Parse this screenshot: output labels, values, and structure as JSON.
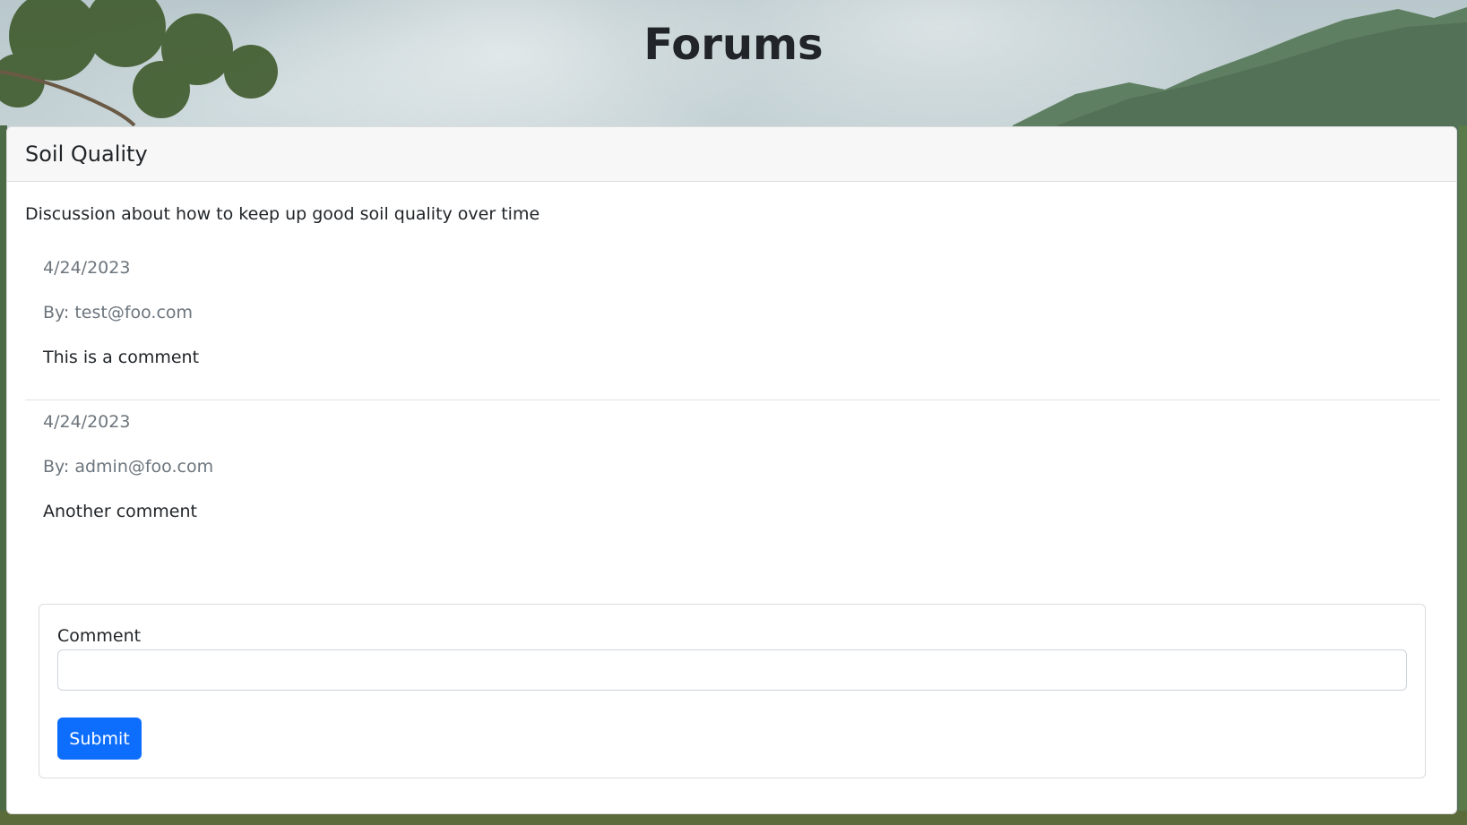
{
  "page": {
    "title": "Forums"
  },
  "forum": {
    "title": "Soil Quality",
    "description": "Discussion about how to keep up good soil quality over time"
  },
  "comments": [
    {
      "date": "4/24/2023",
      "author": "By: test@foo.com",
      "text": "This is a comment"
    },
    {
      "date": "4/24/2023",
      "author": "By: admin@foo.com",
      "text": "Another comment"
    }
  ],
  "form": {
    "label": "Comment",
    "value": "",
    "submit_label": "Submit"
  },
  "colors": {
    "accent": "#0d6efd",
    "muted_text": "#6c757d",
    "text": "#212529"
  }
}
